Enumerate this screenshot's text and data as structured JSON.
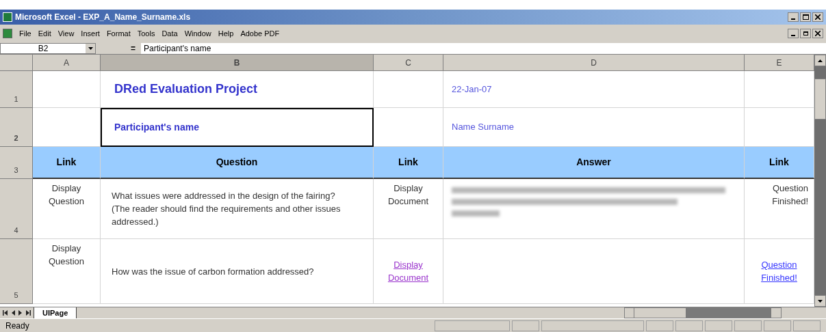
{
  "window": {
    "title": "Microsoft Excel - EXP_A_Name_Surname.xls"
  },
  "menu": [
    "File",
    "Edit",
    "View",
    "Insert",
    "Format",
    "Tools",
    "Data",
    "Window",
    "Help",
    "Adobe PDF"
  ],
  "formula_bar": {
    "name_box": "B2",
    "equals": "=",
    "formula": "Participant's name"
  },
  "columns": [
    {
      "label": "A",
      "selected": false
    },
    {
      "label": "B",
      "selected": true
    },
    {
      "label": "C",
      "selected": false
    },
    {
      "label": "D",
      "selected": false
    },
    {
      "label": "E",
      "selected": false
    }
  ],
  "rows": [
    {
      "number": "1",
      "selected": false,
      "cells": [
        {
          "kind": "empty",
          "selected": false
        },
        {
          "kind": "title",
          "text": "DRed Evaluation Project",
          "selected": false
        },
        {
          "kind": "empty",
          "selected": false
        },
        {
          "kind": "info",
          "text": "22-Jan-07",
          "selected": false
        },
        {
          "kind": "empty",
          "selected": false
        }
      ]
    },
    {
      "number": "2",
      "selected": true,
      "cells": [
        {
          "kind": "empty",
          "selected": false
        },
        {
          "kind": "label",
          "text": "Participant's name",
          "selected": true
        },
        {
          "kind": "empty",
          "selected": false
        },
        {
          "kind": "info",
          "text": "Name Surname",
          "selected": false
        },
        {
          "kind": "empty",
          "selected": false
        }
      ]
    },
    {
      "number": "3",
      "selected": false,
      "cells": [
        {
          "kind": "header",
          "text": "Link",
          "selected": false
        },
        {
          "kind": "header",
          "text": "Question",
          "selected": false
        },
        {
          "kind": "header",
          "text": "Link",
          "selected": false
        },
        {
          "kind": "header",
          "text": "Answer",
          "selected": false
        },
        {
          "kind": "header",
          "text": "Link",
          "selected": false
        }
      ]
    },
    {
      "number": "4",
      "selected": false,
      "cells": [
        {
          "kind": "plain",
          "text": "Display Question",
          "selected": false
        },
        {
          "kind": "question",
          "text": "What issues were addressed in the design of the fairing? (The reader should find the requirements and other issues addressed.)",
          "selected": false
        },
        {
          "kind": "plain",
          "text": "Display Document",
          "selected": false
        },
        {
          "kind": "blurred",
          "selected": false
        },
        {
          "kind": "plain",
          "text": "Question Finished!",
          "selected": false
        }
      ]
    },
    {
      "number": "5",
      "selected": false,
      "cells": [
        {
          "kind": "plain",
          "text": "Display Question",
          "selected": false
        },
        {
          "kind": "question",
          "text": "How was the issue of carbon formation addressed?",
          "selected": false
        },
        {
          "kind": "link",
          "visited": true,
          "text": "Display Document",
          "selected": false
        },
        {
          "kind": "empty",
          "selected": false
        },
        {
          "kind": "link",
          "visited": false,
          "text": "Question Finished!",
          "selected": false
        }
      ]
    }
  ],
  "sheet_tabs": [
    {
      "label": "UIPage",
      "selected": true
    }
  ],
  "status_bar": {
    "text": "Ready"
  }
}
